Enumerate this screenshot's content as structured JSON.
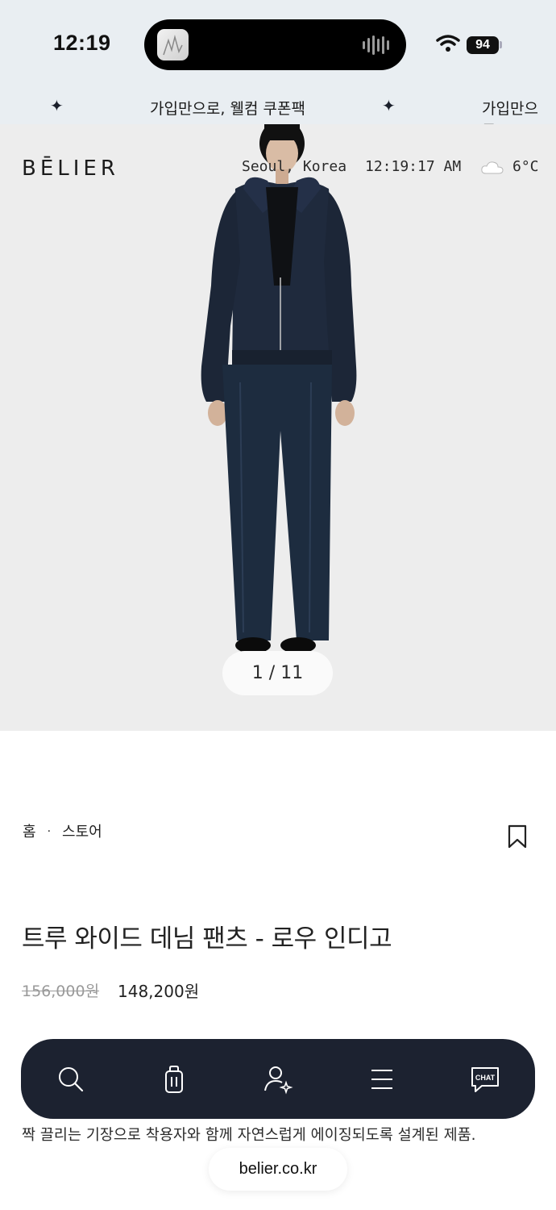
{
  "status_bar": {
    "time": "12:19",
    "battery": "94"
  },
  "marquee": {
    "text": "가입만으로, 웰컴 쿠폰팩",
    "text_repeat": "가입만으로,"
  },
  "header": {
    "logo": "BĒLIER",
    "location": "Seoul, Korea",
    "clock": "12:19:17 AM",
    "temperature": "6°C",
    "weather_icon": "cloud-icon"
  },
  "gallery": {
    "counter": "1 / 11"
  },
  "breadcrumb": {
    "home": "홈",
    "separator": "·",
    "store": "스토어"
  },
  "product": {
    "title": "트루 와이드 데님 팬츠 - 로우 인디고",
    "original_price": "156,000원",
    "sale_price": "148,200원",
    "description_line3": "짝 끌리는 기장으로 착용자와 함께 자연스럽게 에이징되도록 설계된 제품."
  },
  "bottom_nav": {
    "items": [
      "search-icon",
      "bag-icon",
      "account-icon",
      "menu-icon",
      "chat-icon"
    ],
    "chat_label": "CHAT"
  },
  "browser": {
    "url": "belier.co.kr"
  }
}
